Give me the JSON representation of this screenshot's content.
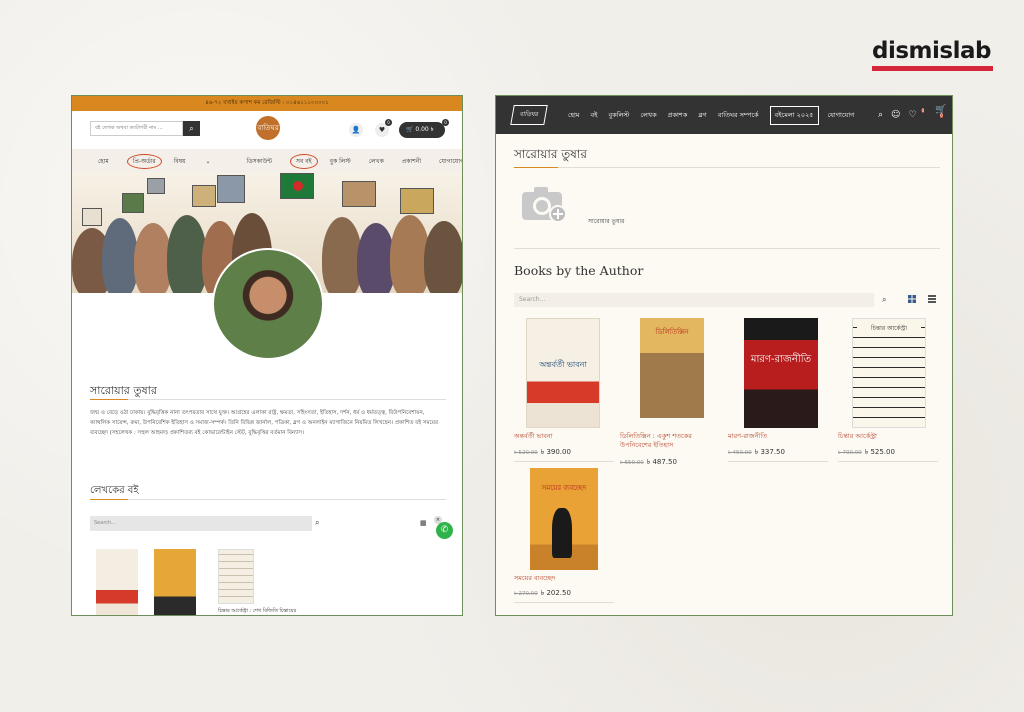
{
  "brand": {
    "name": "dismislab",
    "accent": "#d6263a"
  },
  "left": {
    "topbar": "৪৬-৭২ যখাইয় কপাশ কম রেজিস্টি : ০১৪৬১১১০০০০১",
    "search_placeholder": "বই লেখক অথবা ক্যাটাগরী নাম ...",
    "search_icon": "search-icon",
    "logo_text": "বাতিঘর",
    "cart_total": "0.00 ৳",
    "cart_badge": "0",
    "wish_badge": "0",
    "nav": [
      "হোম",
      "প্রি-অর্ডার",
      "বিষয়",
      "ডিসকাউন্ট",
      "সব বই",
      "বুক লিস্ট",
      "লেখক",
      "প্রকাশনী",
      "যোগাযোগ"
    ],
    "author_name": "সারোয়ার তুষার",
    "bio": "জন্ম ও বেড়ে ওঠা ঢাকায়। বুদ্ধিবৃত্তিক নানা তৎপরতার সাথে যুক্ত। আগ্রহের এলাকা রাষ্ট্র, ক্ষমতা, সহিংসতা, ইতিহাস, দর্শন, ধর্ম ও ধর্মতত্ত্ব, বিউপনিবেশায়ন, ক্যাথলিক সায়েন্স, রুমা, উপনিবেশিক ইতিহাস ও সমাজ-সম্পর্ক। তিনি বিভিন্ন জার্নাল, পত্রিকা, ব্লগ ও অনলাইন ম্যাগাজিনে নিয়মিত লিখছেন। প্রকাশিত বই সময়ের ব্যবচ্ছেদ (সহলেখক : সহুল আহমদ) প্রকাশিতব্য বই কোভারেন্টাইন স্টেট, বুদ্ধিবৃত্তির বর্তমান বিন্যাস।",
    "books_heading": "লেখকের বই",
    "filter_placeholder": "Search...",
    "book_caption": "চিন্তার আর্কেস্ট্রা : শেখ বিজিতি চিন্তায়ের তত্ত্ব",
    "whatsapp_icon": "whatsapp-icon"
  },
  "right": {
    "logo_text": "বাতিঘর",
    "nav": [
      "হোম",
      "বই",
      "বুকলিস্ট",
      "লেখক",
      "প্রকাশক",
      "ব্লগ",
      "বাতিঘর সম্পর্কে"
    ],
    "nav_boxed": "বইমেলা ২০২৫",
    "nav_last": "যোগাযোগ",
    "wish_badge": "0",
    "cart_badge": "0",
    "author_name": "সারোয়ার তুষার",
    "photo_label": "সারোয়ার তুষার",
    "books_heading": "Books by the Author",
    "filter_placeholder": "Search...",
    "books": [
      {
        "title": "অন্তর্বর্তী ভাবনা",
        "old_price": "৳ 520.00",
        "price": "৳ 390.00",
        "cover_text": "অন্তর্বর্তী ভাবনা"
      },
      {
        "title": "ডিলিতিক্সিন : একুশ শতকের উপনিবেশের ইতিহাস",
        "old_price": "৳ 650.00",
        "price": "৳ 487.50",
        "cover_text": "ডিলিতিক্সিন"
      },
      {
        "title": "মারণ-রাজনীতি",
        "old_price": "৳ 450.00",
        "price": "৳ 337.50",
        "cover_text": "মারণ-রাজনীতি"
      },
      {
        "title": "চিন্তার আর্কেস্ট্রা",
        "old_price": "৳ 700.00",
        "price": "৳ 525.00",
        "cover_text": "চিন্তার আর্কেস্ট্রা"
      },
      {
        "title": "সময়ের ব্যবচ্ছেদ",
        "old_price": "৳ 270.00",
        "price": "৳ 202.50",
        "cover_text": "সময়ের ব্যবচ্ছেদ"
      }
    ]
  },
  "colors": {
    "header_orange": "#d9871f",
    "dark": "#333333",
    "link_red": "#b5452a",
    "panel_border": "#6f8f5a"
  }
}
